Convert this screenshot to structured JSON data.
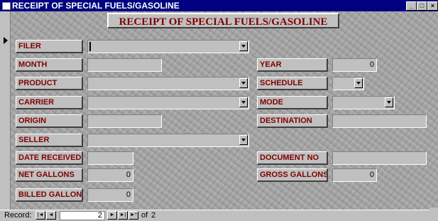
{
  "window": {
    "title": "RECEIPT OF SPECIAL FUELS/GASOLINE"
  },
  "form": {
    "title": "RECEIPT OF SPECIAL FUELS/GASOLINE",
    "labels": {
      "filer": "FILER",
      "month": "MONTH",
      "year": "YEAR",
      "product": "PRODUCT",
      "schedule": "SCHEDULE",
      "carrier": "CARRIER",
      "mode": "MODE",
      "origin": "ORIGIN",
      "destination": "DESTINATION",
      "seller": "SELLER",
      "date_received": "DATE RECEIVED",
      "document_no": "DOCUMENT NO",
      "net_gallons": "NET GALLONS",
      "gross_gallons": "GROSS GALLONS",
      "billed_gallons": "BILLED GALLONS"
    },
    "values": {
      "filer": "",
      "month": "",
      "year": "0",
      "product": "",
      "schedule": "",
      "carrier": "",
      "mode": "",
      "origin": "",
      "destination": "",
      "seller": "",
      "date_received": "",
      "document_no": "",
      "net_gallons": "0",
      "gross_gallons": "0",
      "billed_gallons": "0"
    }
  },
  "statusbar": {
    "record_label": "Record:",
    "current": "2",
    "of_label": "of",
    "total": "2"
  }
}
